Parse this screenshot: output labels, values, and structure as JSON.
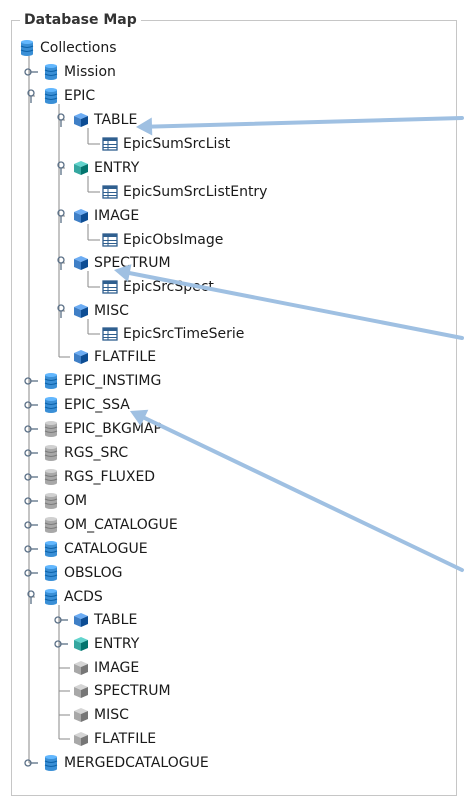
{
  "panel": {
    "title": "Database Map"
  },
  "tree": {
    "root": {
      "label": "Collections",
      "icon": "database-icon",
      "color": "#3a8fd6"
    },
    "nodes": [
      {
        "id": "mission",
        "label": "Mission",
        "icon": "database-icon",
        "color": "#3a8fd6",
        "handle": "collapsed"
      },
      {
        "id": "epic",
        "label": "EPIC",
        "icon": "database-icon",
        "color": "#3a8fd6",
        "handle": "expanded"
      },
      {
        "id": "epic-table",
        "label": "TABLE",
        "icon": "cube-icon",
        "color": "#3f7fc6",
        "handle": "expanded"
      },
      {
        "id": "epic-table-1",
        "label": "EpicSumSrcList",
        "icon": "table-icon"
      },
      {
        "id": "epic-entry",
        "label": "ENTRY",
        "icon": "cube-icon",
        "color": "#35a7a0",
        "handle": "expanded"
      },
      {
        "id": "epic-entry-1",
        "label": "EpicSumSrcListEntry",
        "icon": "table-icon"
      },
      {
        "id": "epic-image",
        "label": "IMAGE",
        "icon": "cube-icon",
        "color": "#3f7fc6",
        "handle": "expanded"
      },
      {
        "id": "epic-image-1",
        "label": "EpicObsImage",
        "icon": "table-icon"
      },
      {
        "id": "epic-spectrum",
        "label": "SPECTRUM",
        "icon": "cube-icon",
        "color": "#3f7fc6",
        "handle": "expanded"
      },
      {
        "id": "epic-spectrum-1",
        "label": "EpicSrcSpect",
        "icon": "table-icon"
      },
      {
        "id": "epic-misc",
        "label": "MISC",
        "icon": "cube-icon",
        "color": "#3f7fc6",
        "handle": "expanded"
      },
      {
        "id": "epic-misc-1",
        "label": "EpicSrcTimeSerie",
        "icon": "table-icon"
      },
      {
        "id": "epic-flatfile",
        "label": "FLATFILE",
        "icon": "cube-icon",
        "color": "#3f7fc6",
        "handle": "none"
      },
      {
        "id": "epic-instimg",
        "label": "EPIC_INSTIMG",
        "icon": "database-icon",
        "color": "#3a8fd6",
        "handle": "collapsed"
      },
      {
        "id": "epic-ssa",
        "label": "EPIC_SSA",
        "icon": "database-icon",
        "color": "#3a8fd6",
        "handle": "collapsed"
      },
      {
        "id": "epic-bkgmap",
        "label": "EPIC_BKGMAP",
        "icon": "database-icon",
        "color": "#a8a8a8",
        "handle": "collapsed"
      },
      {
        "id": "rgs-src",
        "label": "RGS_SRC",
        "icon": "database-icon",
        "color": "#a8a8a8",
        "handle": "collapsed"
      },
      {
        "id": "rgs-fluxed",
        "label": "RGS_FLUXED",
        "icon": "database-icon",
        "color": "#a8a8a8",
        "handle": "collapsed"
      },
      {
        "id": "om",
        "label": "OM",
        "icon": "database-icon",
        "color": "#a8a8a8",
        "handle": "collapsed"
      },
      {
        "id": "om-catalogue",
        "label": "OM_CATALOGUE",
        "icon": "database-icon",
        "color": "#a8a8a8",
        "handle": "collapsed"
      },
      {
        "id": "catalogue",
        "label": "CATALOGUE",
        "icon": "database-icon",
        "color": "#3a8fd6",
        "handle": "collapsed"
      },
      {
        "id": "obslog",
        "label": "OBSLOG",
        "icon": "database-icon",
        "color": "#3a8fd6",
        "handle": "collapsed"
      },
      {
        "id": "acds",
        "label": "ACDS",
        "icon": "database-icon",
        "color": "#3a8fd6",
        "handle": "expanded"
      },
      {
        "id": "acds-table",
        "label": "TABLE",
        "icon": "cube-icon",
        "color": "#3f7fc6",
        "handle": "collapsed"
      },
      {
        "id": "acds-entry",
        "label": "ENTRY",
        "icon": "cube-icon",
        "color": "#35a7a0",
        "handle": "collapsed"
      },
      {
        "id": "acds-image",
        "label": "IMAGE",
        "icon": "cube-icon",
        "color": "#a8a8a8",
        "handle": "none"
      },
      {
        "id": "acds-spectrum",
        "label": "SPECTRUM",
        "icon": "cube-icon",
        "color": "#a8a8a8",
        "handle": "none"
      },
      {
        "id": "acds-misc",
        "label": "MISC",
        "icon": "cube-icon",
        "color": "#a8a8a8",
        "handle": "none"
      },
      {
        "id": "acds-flatfile",
        "label": "FLATFILE",
        "icon": "cube-icon",
        "color": "#a8a8a8",
        "handle": "none"
      },
      {
        "id": "mergedcatalogue",
        "label": "MERGEDCATALOGUE",
        "icon": "database-icon",
        "color": "#3a8fd6",
        "handle": "collapsed"
      }
    ]
  },
  "annotations": {
    "arrow_color": "#9fc0e2",
    "icon": "arrow-icon"
  }
}
